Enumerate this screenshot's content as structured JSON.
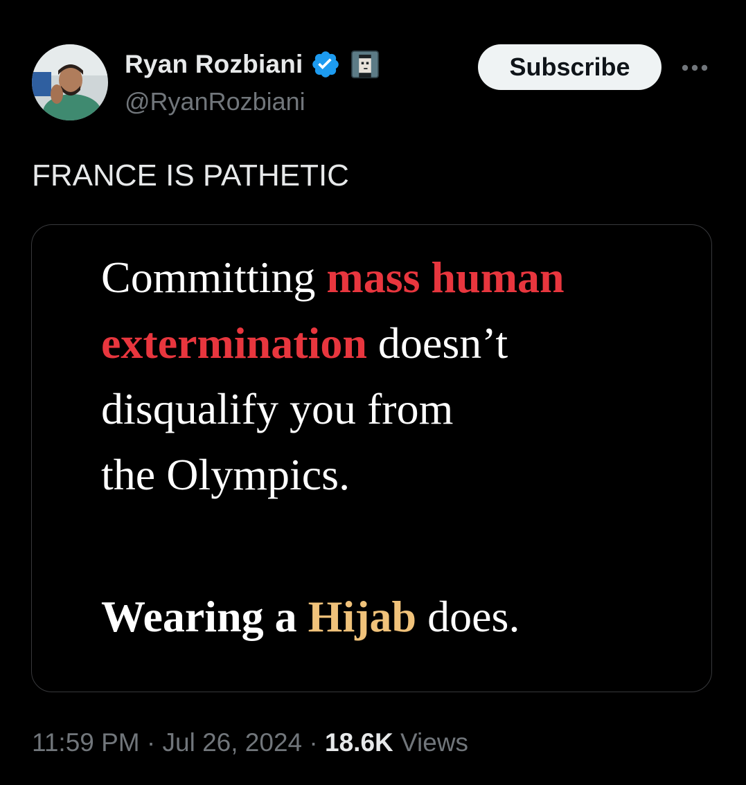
{
  "author": {
    "display_name": "Ryan Rozbiani",
    "handle": "@RyanRozbiani",
    "avatar_icon": "profile-photo",
    "verified_icon": "verified-badge-icon",
    "badge_icon": "pixel-punk-badge-icon"
  },
  "header": {
    "subscribe_label": "Subscribe",
    "more_icon": "more-horizontal-icon"
  },
  "tweet": {
    "text": "FRANCE IS PATHETIC"
  },
  "media": {
    "line1_a": "Committing ",
    "line1_b": "mass human",
    "line2_a": "extermination",
    "line2_b": " doesn’t",
    "line3": "disqualify you from",
    "line4": "the Olympics.",
    "line5_a": "Wearing a ",
    "line5_b": "Hijab",
    "line5_c": " does."
  },
  "meta": {
    "time": "11:59 PM",
    "sep1": " · ",
    "date": "Jul 26, 2024",
    "sep2": " · ",
    "views_count": "18.6K",
    "views_label": " Views"
  },
  "colors": {
    "background": "#000000",
    "text_primary": "#e7e9ea",
    "text_secondary": "#71767b",
    "verified_blue": "#1d9bf0",
    "highlight_red": "#e8363e",
    "highlight_gold": "#f0c27a",
    "card_border": "#38393c"
  }
}
